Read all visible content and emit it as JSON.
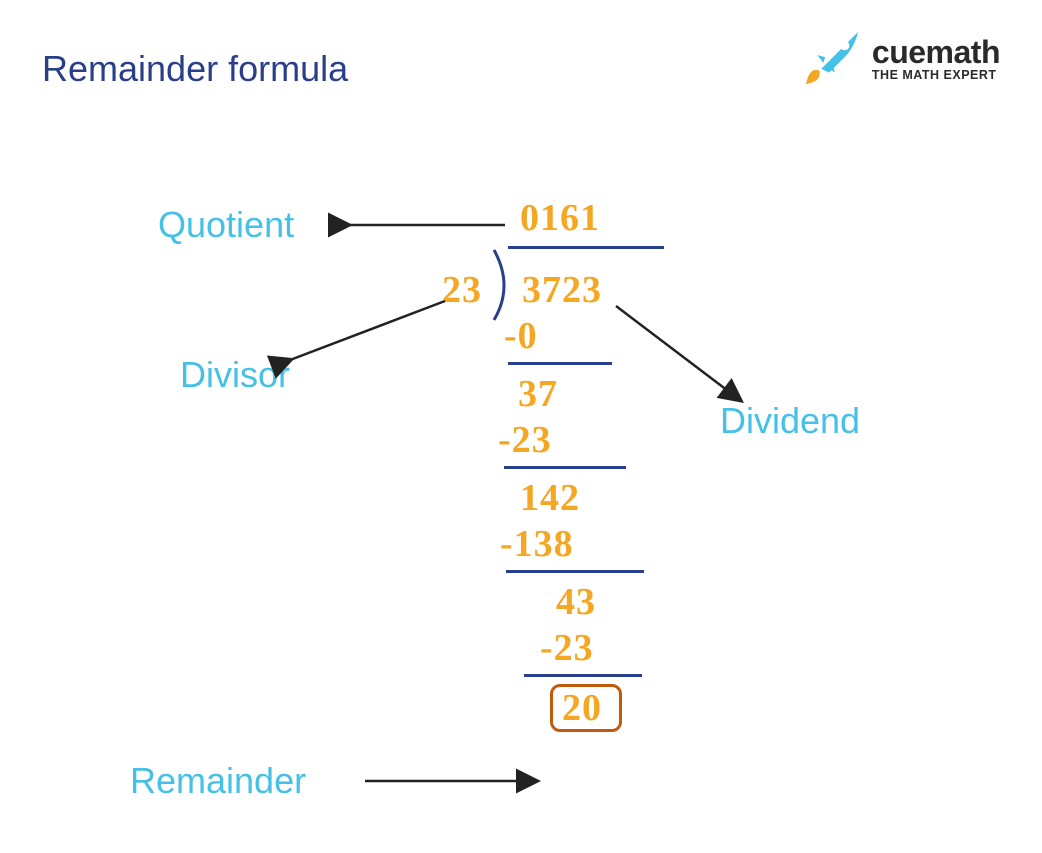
{
  "title": "Remainder formula",
  "logo": {
    "brand": "cuemath",
    "tagline": "THE MATH EXPERT"
  },
  "labels": {
    "quotient": "Quotient",
    "divisor": "Divisor",
    "dividend": "Dividend",
    "remainder": "Remainder"
  },
  "division": {
    "quotient": "0161",
    "divisor": "23",
    "dividend": "3723",
    "steps": [
      {
        "sub": "-0"
      },
      {
        "bring": "37",
        "sub": "-23"
      },
      {
        "bring": "142",
        "sub": "-138"
      },
      {
        "bring": "43",
        "sub": "-23"
      }
    ],
    "remainder": "20"
  }
}
